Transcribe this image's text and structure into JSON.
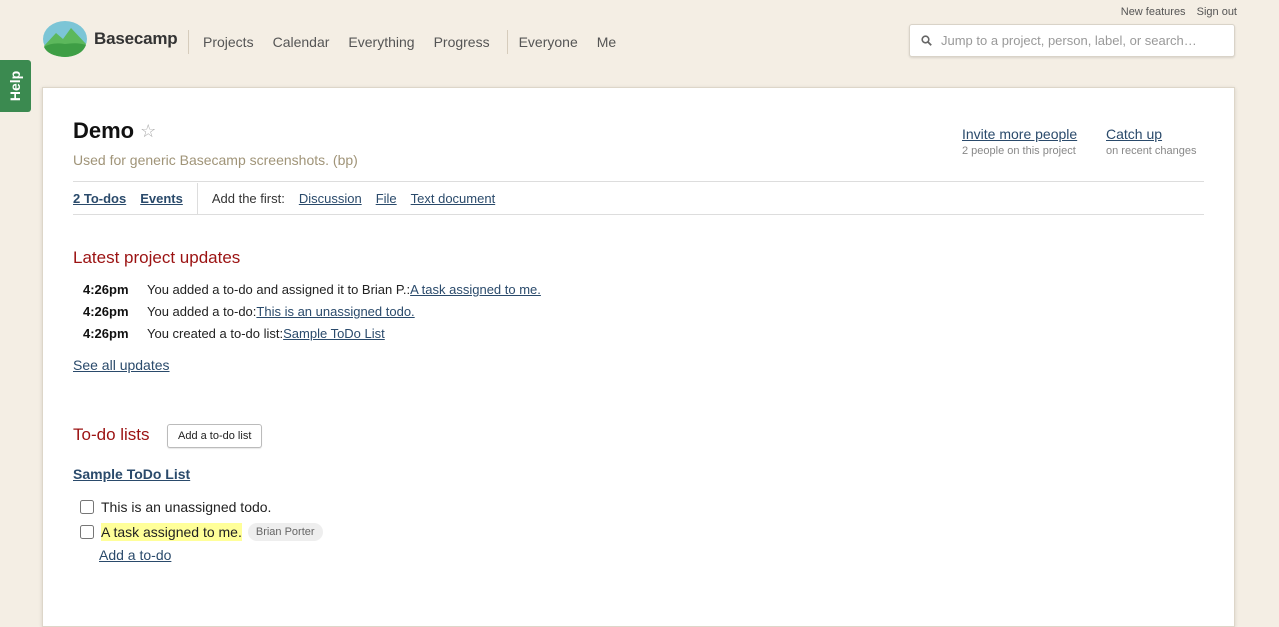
{
  "top_links": {
    "new_features": "New features",
    "sign_out": "Sign out"
  },
  "brand": {
    "name": "Basecamp",
    "help": "Help"
  },
  "nav": {
    "primary": [
      "Projects",
      "Calendar",
      "Everything",
      "Progress"
    ],
    "secondary": [
      "Everyone",
      "Me"
    ]
  },
  "search": {
    "placeholder": "Jump to a project, person, label, or search…"
  },
  "project": {
    "title": "Demo",
    "description": "Used for generic Basecamp screenshots. (bp)",
    "invite": {
      "label": "Invite more people",
      "sub": "2 people on this project"
    },
    "catch_up": {
      "label": "Catch up",
      "sub": "on recent changes"
    }
  },
  "tools": {
    "todos": "2 To-dos",
    "events": "Events",
    "add_first": "Add the first:",
    "discussion": "Discussion",
    "file": "File",
    "text_document": "Text document"
  },
  "updates": {
    "title": "Latest project updates",
    "items": [
      {
        "time": "4:26pm",
        "text": "You added a to-do and assigned it to Brian P.: ",
        "link": "A task assigned to me."
      },
      {
        "time": "4:26pm",
        "text": "You added a to-do: ",
        "link": "This is an unassigned todo."
      },
      {
        "time": "4:26pm",
        "text": "You created a to-do list: ",
        "link": "Sample ToDo List"
      }
    ],
    "see_all": "See all updates"
  },
  "todo_lists": {
    "title": "To-do lists",
    "add_button": "Add a to-do list",
    "list_name": "Sample ToDo List",
    "items": [
      {
        "text": "This is an unassigned todo.",
        "assignee": ""
      },
      {
        "text": "A task assigned to me.",
        "assignee": "Brian Porter"
      }
    ],
    "add_todo": "Add a to-do"
  },
  "colors": {
    "background": "#f4eee4",
    "accent_red": "#9b1212",
    "link": "#2a4a6b",
    "help_tab": "#3b8a50",
    "highlight": "#ffff99"
  }
}
